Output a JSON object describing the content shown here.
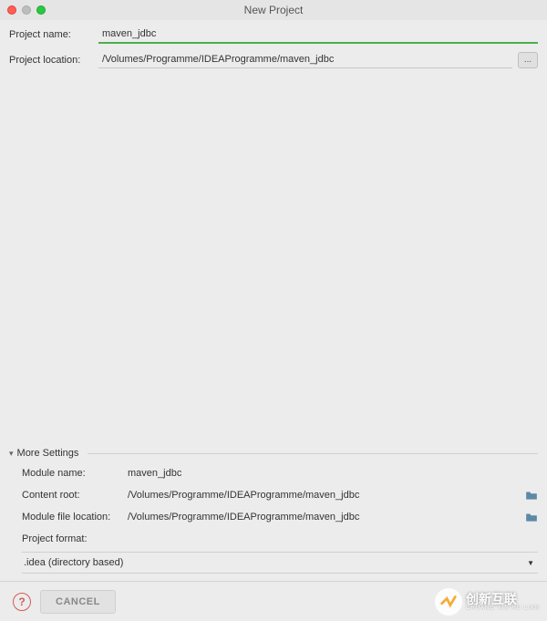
{
  "window": {
    "title": "New Project"
  },
  "project": {
    "name_label": "Project name:",
    "name_value": "maven_jdbc",
    "location_label": "Project location:",
    "location_value": "/Volumes/Programme/IDEAProgramme/maven_jdbc",
    "browse_label": "..."
  },
  "more": {
    "header": "More Settings",
    "module_name_label": "Module name:",
    "module_name_value": "maven_jdbc",
    "content_root_label": "Content root:",
    "content_root_value": "/Volumes/Programme/IDEAProgramme/maven_jdbc",
    "module_file_label": "Module file location:",
    "module_file_value": "/Volumes/Programme/IDEAProgramme/maven_jdbc",
    "format_label": "Project format:",
    "format_value": ".idea (directory based)"
  },
  "buttons": {
    "help": "?",
    "cancel": "CANCEL"
  },
  "watermark": {
    "title": "创新互联",
    "sub": "CHUANG XIN HU LIAN"
  }
}
